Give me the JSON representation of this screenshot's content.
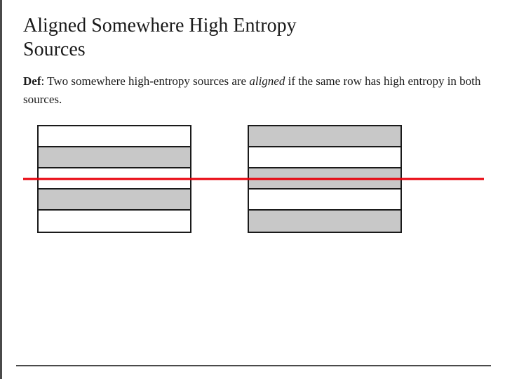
{
  "page": {
    "title_line1": "Aligned Somewhere High Entropy",
    "title_line2": "Sources",
    "definition_label": "Def",
    "definition_colon": ":",
    "definition_text": " Two somewhere high-entropy sources are ",
    "definition_italic": "aligned",
    "definition_text2": " if the same row has high entropy in both sources.",
    "red_line_color": "#e8000a",
    "border_color": "#4a4a4a",
    "diagram1": {
      "rows": [
        {
          "type": "white"
        },
        {
          "type": "highlighted"
        },
        {
          "type": "white"
        },
        {
          "type": "highlighted"
        },
        {
          "type": "white"
        }
      ]
    },
    "diagram2": {
      "rows": [
        {
          "type": "highlighted"
        },
        {
          "type": "white"
        },
        {
          "type": "highlighted"
        },
        {
          "type": "white"
        },
        {
          "type": "highlighted"
        }
      ]
    }
  }
}
